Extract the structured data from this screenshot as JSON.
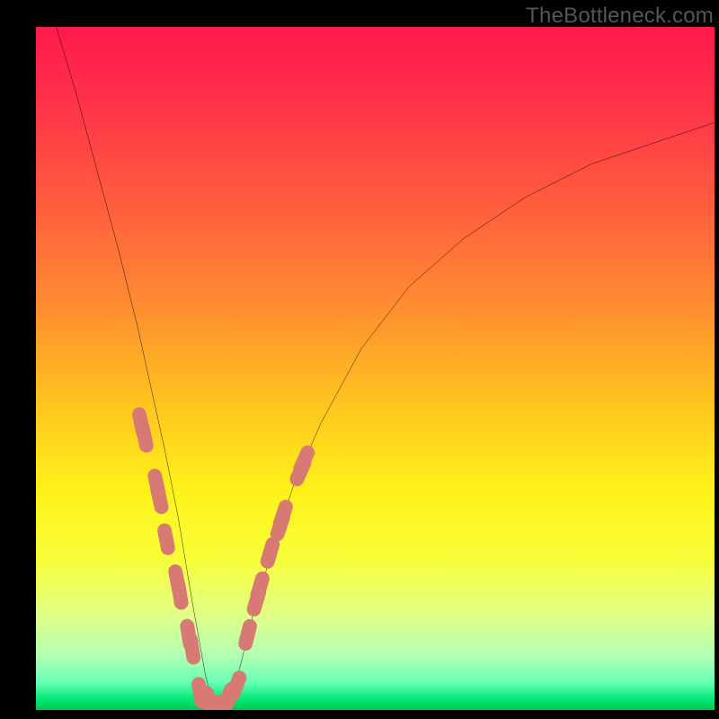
{
  "watermark": "TheBottleneck.com",
  "colors": {
    "gradient_stops": [
      {
        "offset": 0.0,
        "color": "#ff1a4d"
      },
      {
        "offset": 0.1,
        "color": "#ff2f4a"
      },
      {
        "offset": 0.25,
        "color": "#ff5a3e"
      },
      {
        "offset": 0.4,
        "color": "#ff8a32"
      },
      {
        "offset": 0.55,
        "color": "#ffc41f"
      },
      {
        "offset": 0.68,
        "color": "#fff21a"
      },
      {
        "offset": 0.78,
        "color": "#f7ff3a"
      },
      {
        "offset": 0.86,
        "color": "#e1ff86"
      },
      {
        "offset": 0.92,
        "color": "#b3ffb3"
      },
      {
        "offset": 0.96,
        "color": "#66ffb3"
      },
      {
        "offset": 0.985,
        "color": "#00e676"
      },
      {
        "offset": 1.0,
        "color": "#00c853"
      }
    ],
    "dot": "#d77a73",
    "curve": "#000000",
    "frame": "#000000"
  },
  "chart_data": {
    "type": "line",
    "title": "",
    "xlabel": "",
    "ylabel": "",
    "xlim": [
      0,
      100
    ],
    "ylim": [
      0,
      100
    ],
    "grid": false,
    "note": "V-shaped bottleneck curve; y is mismatch severity (0 = ideal, 100 = severe). Minimum near x≈26 where y≈0. Values read from pixel positions; axes unlabeled in source.",
    "series": [
      {
        "name": "bottleneck-curve",
        "x": [
          3,
          6,
          9,
          12,
          15,
          17,
          19,
          21,
          23,
          25,
          26,
          27,
          28,
          30,
          32,
          35,
          38,
          42,
          48,
          55,
          63,
          72,
          82,
          94,
          100
        ],
        "y": [
          100,
          90,
          79,
          68,
          56,
          47,
          38,
          28,
          16,
          5,
          1,
          1,
          1,
          6,
          14,
          24,
          33,
          42,
          53,
          62,
          69,
          75,
          80,
          84,
          86
        ]
      }
    ],
    "marker_clusters": [
      {
        "name": "left-arm-dots",
        "points": [
          {
            "x": 15.5,
            "y": 42
          },
          {
            "x": 16.0,
            "y": 40
          },
          {
            "x": 17.8,
            "y": 33
          },
          {
            "x": 18.2,
            "y": 31
          },
          {
            "x": 19.2,
            "y": 25
          },
          {
            "x": 20.8,
            "y": 19
          },
          {
            "x": 21.2,
            "y": 17
          },
          {
            "x": 22.5,
            "y": 11
          },
          {
            "x": 23.0,
            "y": 9
          }
        ]
      },
      {
        "name": "bottom-dots",
        "points": [
          {
            "x": 24.2,
            "y": 2.5
          },
          {
            "x": 25.5,
            "y": 1.2
          },
          {
            "x": 27.0,
            "y": 1.2
          },
          {
            "x": 28.3,
            "y": 1.8
          },
          {
            "x": 29.5,
            "y": 3.5
          }
        ]
      },
      {
        "name": "right-arm-dots",
        "points": [
          {
            "x": 31.2,
            "y": 11
          },
          {
            "x": 32.5,
            "y": 16
          },
          {
            "x": 33.0,
            "y": 18
          },
          {
            "x": 34.5,
            "y": 23
          },
          {
            "x": 36.0,
            "y": 27
          },
          {
            "x": 36.4,
            "y": 28.5
          },
          {
            "x": 39.0,
            "y": 35
          },
          {
            "x": 39.5,
            "y": 36.5
          }
        ]
      }
    ]
  }
}
